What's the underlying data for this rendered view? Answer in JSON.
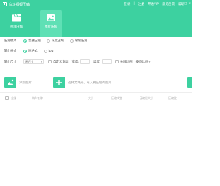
{
  "app": {
    "title": "白斗视频压缩"
  },
  "top_links": [
    "登录",
    "注册",
    "开通VIP",
    "意见反馈",
    "帮助"
  ],
  "top_link_separator": "|",
  "window_controls": [
    "—",
    "□",
    "×"
  ],
  "tabs": [
    {
      "label": "视频压缩",
      "icon": "clapperboard-icon",
      "active": false
    },
    {
      "label": "图片压缩",
      "icon": "image-icon",
      "active": true
    }
  ],
  "compress_mode": {
    "label": "压缩模式",
    "options": [
      "普通压缩",
      "深度压缩",
      "极限压缩"
    ],
    "selected": 0
  },
  "output_format": {
    "label": "输出格式",
    "options": [
      "原格式",
      "jpg"
    ],
    "selected": 0
  },
  "output_size": {
    "label": "输出尺寸",
    "select_value": "原尺寸",
    "custom_label": "自定义宽高",
    "width_label": "宽度:",
    "height_label": "高度:",
    "ratio_label": "分屏比例",
    "ratio_value": "按原比例"
  },
  "toolbar": {
    "add_image": "添加图片",
    "add_folder": "选择文件夹，导入要压缩的图片"
  },
  "table": {
    "columns": [
      "全选",
      "文件名称",
      "大小",
      "压缩状态",
      "压缩后大小",
      "压缩比"
    ]
  },
  "colors": {
    "accent": "#3dd1a0",
    "tab_active": "#5fe0b5"
  }
}
